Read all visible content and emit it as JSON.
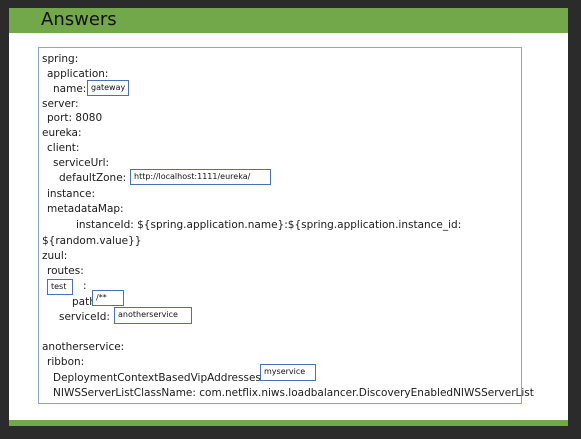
{
  "title": "Answers",
  "lines": {
    "spring": "spring:",
    "application": "application:",
    "name_key": "name:",
    "server": "server:",
    "port": "port: 8080",
    "eureka": "eureka:",
    "client": "client:",
    "serviceUrl": "serviceUrl:",
    "defaultZone": "defaultZone:",
    "instance": "instance:",
    "metadataMap": "metadataMap:",
    "instanceId": "instanceId: ${spring.application.name}:${spring.application.instance_id:",
    "random_value": "${random.value}}",
    "zuul": "zuul:",
    "routes": "routes:",
    "colon": ":",
    "path": "path:",
    "serviceId": "serviceId:",
    "anotherservice": "anotherservice:",
    "ribbon": "ribbon:",
    "dcbva": "DeploymentContextBasedVipAddresses:",
    "niws": "NIWSServerListClassName: com.netflix.niws.loadbalancer.DiscoveryEnabledNIWSServerList"
  },
  "answers": {
    "name": "gateway",
    "defaultZone": "http://localhost:1111/eureka/",
    "route": "test",
    "path": "/**",
    "serviceId": "anotherservice",
    "vip": "myservice"
  }
}
